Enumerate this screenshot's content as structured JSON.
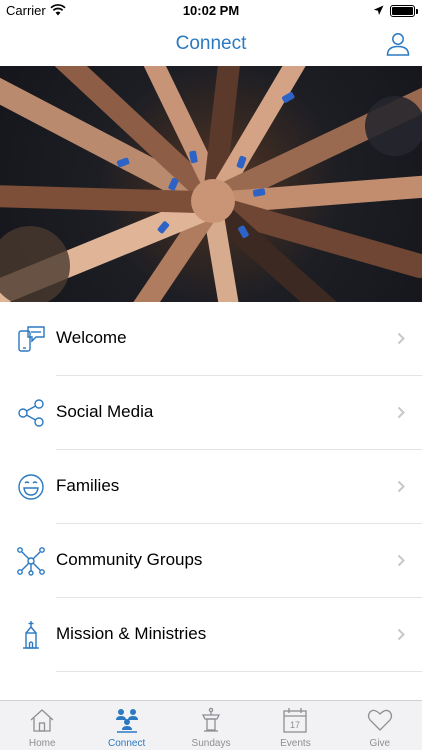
{
  "status_bar": {
    "carrier": "Carrier",
    "time": "10:02 PM"
  },
  "nav": {
    "title": "Connect"
  },
  "menu": [
    {
      "label": "Welcome",
      "icon": "phone-chat-icon"
    },
    {
      "label": "Social Media",
      "icon": "share-icon"
    },
    {
      "label": "Families",
      "icon": "smiley-icon"
    },
    {
      "label": "Community Groups",
      "icon": "network-icon"
    },
    {
      "label": "Mission & Ministries",
      "icon": "chapel-icon"
    }
  ],
  "tabs": [
    {
      "label": "Home",
      "icon": "house-icon",
      "active": false
    },
    {
      "label": "Connect",
      "icon": "people-icon",
      "active": true
    },
    {
      "label": "Sundays",
      "icon": "podium-icon",
      "active": false
    },
    {
      "label": "Events",
      "icon": "calendar-icon",
      "active": false,
      "calendar_day": "17"
    },
    {
      "label": "Give",
      "icon": "heart-icon",
      "active": false
    }
  ],
  "colors": {
    "accent": "#2b79c2",
    "inactive": "#8e8e93",
    "divider": "#e3e3e8",
    "tab_bar_bg": "#f2f2f4"
  }
}
